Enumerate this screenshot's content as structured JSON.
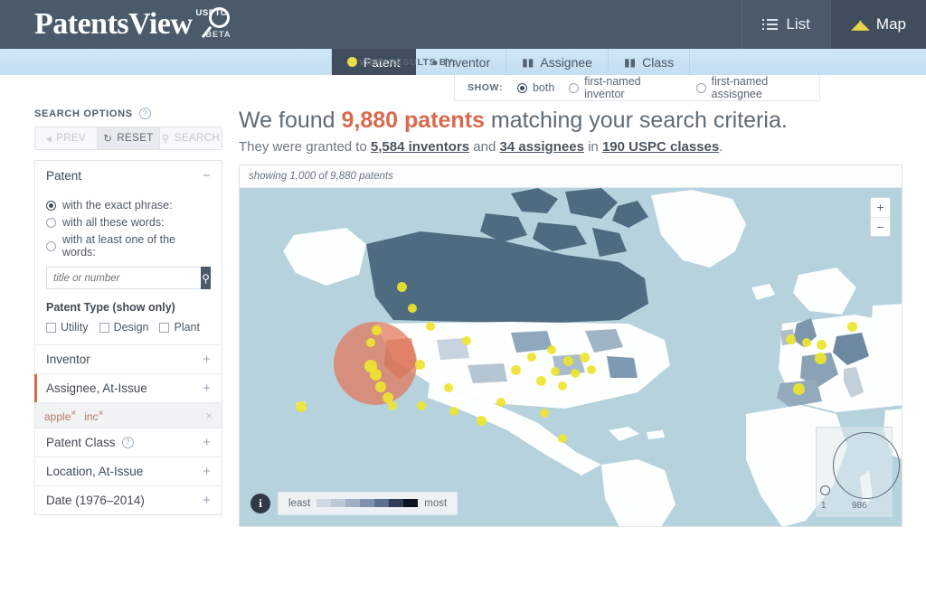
{
  "brand": {
    "name": "PatentsView",
    "super": "USPTO",
    "sub": "BETA",
    "logo_icon": "magnifier-icon"
  },
  "topnav": {
    "items": [
      {
        "label": "List",
        "icon": "list-icon",
        "active": false
      },
      {
        "label": "Map",
        "icon": "world-map-icon",
        "active": true
      }
    ]
  },
  "viewbar": {
    "label": "VIEW RESULTS BY:",
    "tabs": [
      {
        "label": "Patent",
        "icon": "yellow-dot-icon",
        "active": true
      },
      {
        "label": "Inventor",
        "icon": "bulb-icon",
        "active": false
      },
      {
        "label": "Assignee",
        "icon": "briefcase-icon",
        "active": false
      },
      {
        "label": "Class",
        "icon": "briefcase-icon",
        "active": false
      }
    ]
  },
  "showbar": {
    "label": "SHOW:",
    "options": [
      {
        "label": "both",
        "selected": true
      },
      {
        "label": "first-named inventor",
        "selected": false
      },
      {
        "label": "first-named assisgnee",
        "selected": false
      }
    ]
  },
  "sidebar": {
    "title": "SEARCH OPTIONS",
    "help_icon": "question-icon",
    "buttons": [
      {
        "label": "PREV",
        "icon": "arrow-left-icon",
        "enabled": false
      },
      {
        "label": "RESET",
        "icon": "refresh-icon",
        "enabled": true
      },
      {
        "label": "SEARCH",
        "icon": "search-icon",
        "enabled": false
      }
    ],
    "patent_panel": {
      "title": "Patent",
      "toggle": "−",
      "radios": [
        {
          "label": "with the exact phrase:",
          "selected": true
        },
        {
          "label": "with all these words:",
          "selected": false
        },
        {
          "label": "with at least one of the words:",
          "selected": false
        }
      ],
      "search_placeholder": "title or number",
      "search_value": "",
      "search_icon": "search-icon",
      "type_label": "Patent Type (show only)",
      "checkboxes": [
        {
          "label": "Utility",
          "checked": false
        },
        {
          "label": "Design",
          "checked": false
        },
        {
          "label": "Plant",
          "checked": false
        }
      ]
    },
    "sections": [
      {
        "label": "Inventor",
        "toggle": "+",
        "help": false
      },
      {
        "label": "Assignee, At-Issue",
        "toggle": "+",
        "help": false
      },
      {
        "label": "Patent Class",
        "toggle": "+",
        "help": true
      },
      {
        "label": "Location, At-Issue",
        "toggle": "+",
        "help": false
      },
      {
        "label": "Date (1976–2014)",
        "toggle": "+",
        "help": false
      }
    ],
    "assignee_tags": {
      "tags": [
        "apple",
        "inc"
      ],
      "remove_glyph": "×",
      "clear_glyph": "×"
    }
  },
  "results": {
    "prefix": "We found ",
    "count": "9,880 patents",
    "suffix": " matching your search criteria.",
    "sub_prefix": "They were granted to ",
    "inventors": "5,584 inventors",
    "sub_mid": " and ",
    "assignees": "34 assignees",
    "sub_mid2": " in ",
    "classes": "190 USPC classes",
    "sub_end": "."
  },
  "map": {
    "caption": "showing 1,000 of 9,880 patents",
    "zoom_in": "+",
    "zoom_out": "−",
    "info_icon": "info-icon",
    "legend": {
      "least": "least",
      "most": "most"
    },
    "size_legend": {
      "min": "1",
      "max": "986"
    },
    "colors": {
      "ocean": "#b5d2dd",
      "land": "#fdfefe",
      "choropleth_dark": "#4e6b81",
      "bubble": "#e27456",
      "dot": "#ede52f"
    },
    "gradient_steps": [
      "#cfd9e4",
      "#bcc8d8",
      "#9fb0c6",
      "#7f93ae",
      "#5a7090",
      "#2f3e55",
      "#0d1420"
    ]
  }
}
